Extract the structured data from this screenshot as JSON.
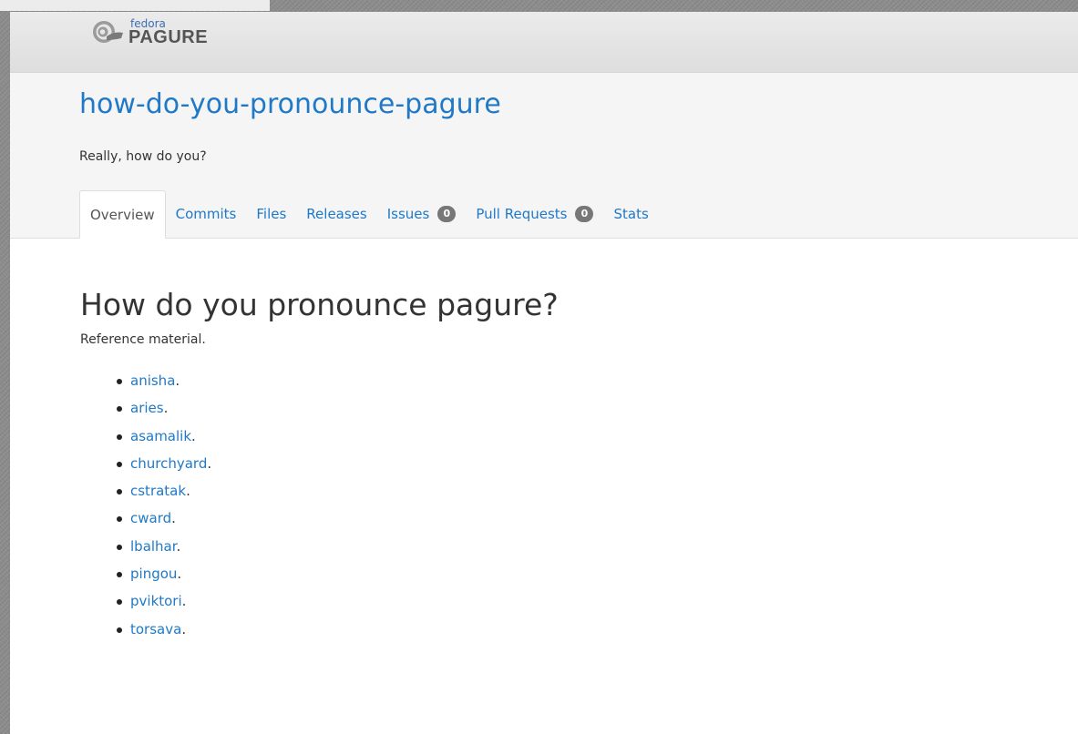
{
  "brand": {
    "fedora": "fedora",
    "pagure": "PAGURE",
    "logo_icon": "pagure-shell-icon"
  },
  "project": {
    "name": "how-do-you-pronounce-pagure",
    "description": "Really, how do you?"
  },
  "tabs": [
    {
      "label": "Overview",
      "active": true
    },
    {
      "label": "Commits"
    },
    {
      "label": "Files"
    },
    {
      "label": "Releases"
    },
    {
      "label": "Issues",
      "count": "0"
    },
    {
      "label": "Pull Requests",
      "count": "0"
    },
    {
      "label": "Stats"
    }
  ],
  "readme": {
    "title": "How do you pronounce pagure?",
    "intro": "Reference material.",
    "people": [
      "anisha",
      "aries",
      "asamalik",
      "churchyard",
      "cstratak",
      "cward",
      "lbalhar",
      "pingou",
      "pviktori",
      "torsava"
    ],
    "separator": "."
  },
  "colors": {
    "link": "#1f79c7",
    "badge": "#777777",
    "header_bg": "#f5f5f5"
  }
}
